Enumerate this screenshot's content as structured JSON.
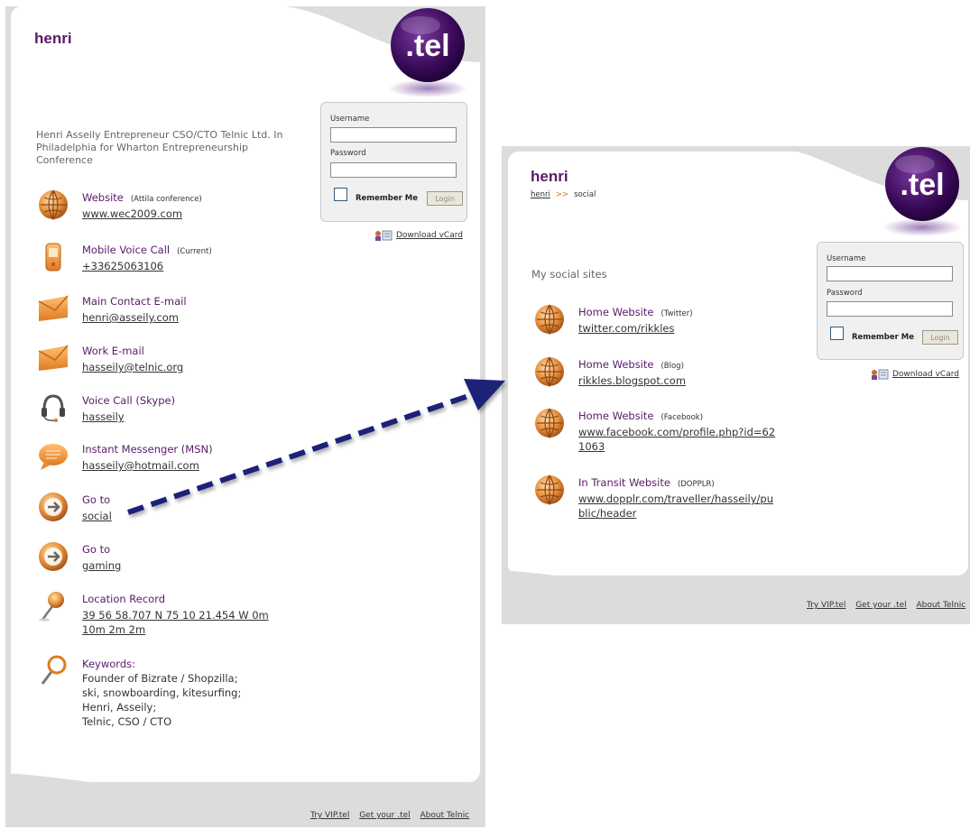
{
  "left": {
    "brand": "henri",
    "logo_text": ".tel",
    "intro": "Henri Asseily Entrepreneur CSO/CTO Telnic Ltd. In Philadelphia for Wharton Entrepreneurship Conference",
    "login": {
      "username_label": "Username",
      "password_label": "Password",
      "remember_label": "Remember Me",
      "login_button": "Login"
    },
    "vcard": "Download vCard",
    "entries": [
      {
        "icon": "globe-icon",
        "label": "Website",
        "note": "(Attila conference)",
        "value": "www.wec2009.com"
      },
      {
        "icon": "mobile-phone-icon",
        "label": "Mobile Voice Call",
        "note": "(Current)",
        "value": "+33625063106"
      },
      {
        "icon": "envelope-icon",
        "label": "Main Contact E-mail",
        "note": "",
        "value": "henri@asseily.com"
      },
      {
        "icon": "envelope-icon",
        "label": "Work E-mail",
        "note": "",
        "value": "hasseily@telnic.org"
      },
      {
        "icon": "headset-icon",
        "label": "Voice Call (Skype)",
        "note": "",
        "value": "hasseily"
      },
      {
        "icon": "chat-bubble-icon",
        "label": "Instant Messenger (MSN)",
        "note": "",
        "value": "hasseily@hotmail.com"
      },
      {
        "icon": "goto-arrow-icon",
        "label": "Go to",
        "note": "",
        "value": "social"
      },
      {
        "icon": "goto-arrow-icon",
        "label": "Go to",
        "note": "",
        "value": "gaming"
      },
      {
        "icon": "map-pin-icon",
        "label": "Location Record",
        "note": "",
        "value": "39 56 58.707 N 75 10 21.454 W 0m 10m 2m 2m"
      }
    ],
    "keywords": {
      "label": "Keywords:",
      "lines": [
        "Founder of Bizrate / Shopzilla;",
        "ski, snowboarding, kitesurfing;",
        "Henri, Asseily;",
        "Telnic, CSO / CTO"
      ]
    },
    "footer": [
      "Try VIP.tel",
      "Get your .tel",
      "About Telnic"
    ]
  },
  "right": {
    "brand": "henri",
    "logo_text": ".tel",
    "breadcrumb": {
      "home": "henri",
      "sep": ">>",
      "current": "social"
    },
    "section_title": "My social sites",
    "login": {
      "username_label": "Username",
      "password_label": "Password",
      "remember_label": "Remember Me",
      "login_button": "Login"
    },
    "vcard": "Download vCard",
    "entries": [
      {
        "icon": "globe-icon",
        "label": "Home Website",
        "note": "(Twitter)",
        "value": "twitter.com/rikkles"
      },
      {
        "icon": "globe-icon",
        "label": "Home Website",
        "note": "(Blog)",
        "value": "rikkles.blogspot.com"
      },
      {
        "icon": "globe-icon",
        "label": "Home Website",
        "note": "(Facebook)",
        "value": "www.facebook.com/profile.php?id=621063"
      },
      {
        "icon": "globe-icon",
        "label": "In Transit Website",
        "note": "(DOPPLR)",
        "value": "www.dopplr.com/traveller/hasseily/public/header"
      }
    ],
    "footer": [
      "Try VIP.tel",
      "Get your .tel",
      "About Telnic"
    ]
  },
  "colors": {
    "brand_purple": "#5a1a6a",
    "panel_gray": "#dcdcdc",
    "arrow_navy": "#1a2478"
  }
}
